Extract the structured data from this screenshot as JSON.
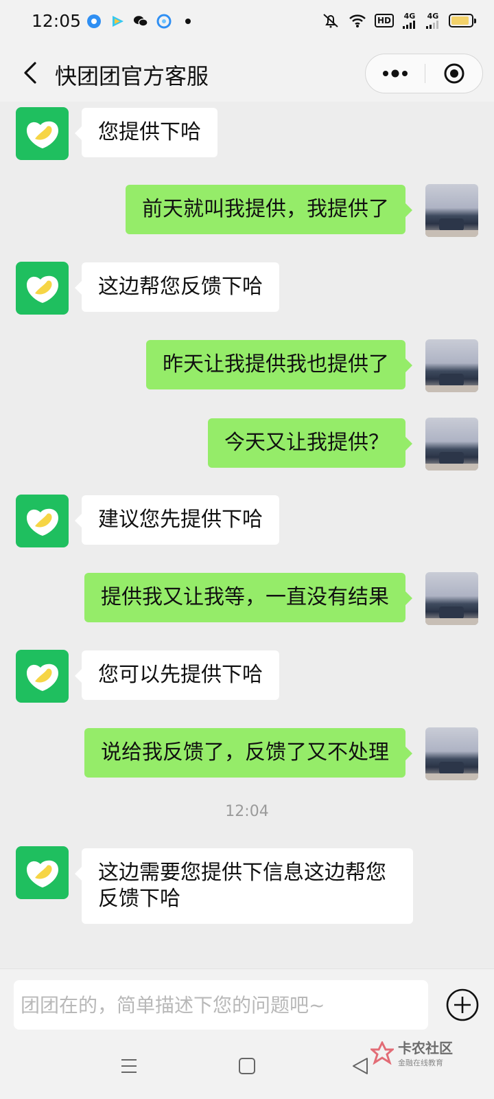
{
  "status_bar": {
    "time": "12:05",
    "apps": [
      "browser-icon",
      "video-icon",
      "wechat-icon",
      "cloud-icon"
    ],
    "hd": "HD",
    "net1": "4G",
    "net2": "4G",
    "battery_level": 0.9
  },
  "header": {
    "title": "快团团官方客服",
    "more_icon": "more-dots-icon",
    "close_icon": "target-circle-icon"
  },
  "messages": [
    {
      "side": "bot",
      "text": "您提供下哈"
    },
    {
      "side": "me",
      "text": "前天就叫我提供，我提供了"
    },
    {
      "side": "bot",
      "text": "这边帮您反馈下哈"
    },
    {
      "side": "me",
      "text": "昨天让我提供我也提供了"
    },
    {
      "side": "me",
      "text": "今天又让我提供？"
    },
    {
      "side": "bot",
      "text": "建议您先提供下哈"
    },
    {
      "side": "me",
      "text": "提供我又让我等，一直没有结果"
    },
    {
      "side": "bot",
      "text": "您可以先提供下哈"
    },
    {
      "side": "me",
      "text": "说给我反馈了，反馈了又不处理"
    },
    {
      "side": "time",
      "text": "12:04"
    },
    {
      "side": "bot",
      "text": "这边需要您提供下信息这边帮您反馈下哈"
    }
  ],
  "input": {
    "placeholder": "团团在的，简单描述下您的问题吧~",
    "value": ""
  },
  "watermark": {
    "title": "卡农社区",
    "subtitle": "金融在线教育"
  },
  "colors": {
    "bot_avatar": "#1fbf5f",
    "my_bubble": "#95ec69",
    "background": "#ededed"
  }
}
